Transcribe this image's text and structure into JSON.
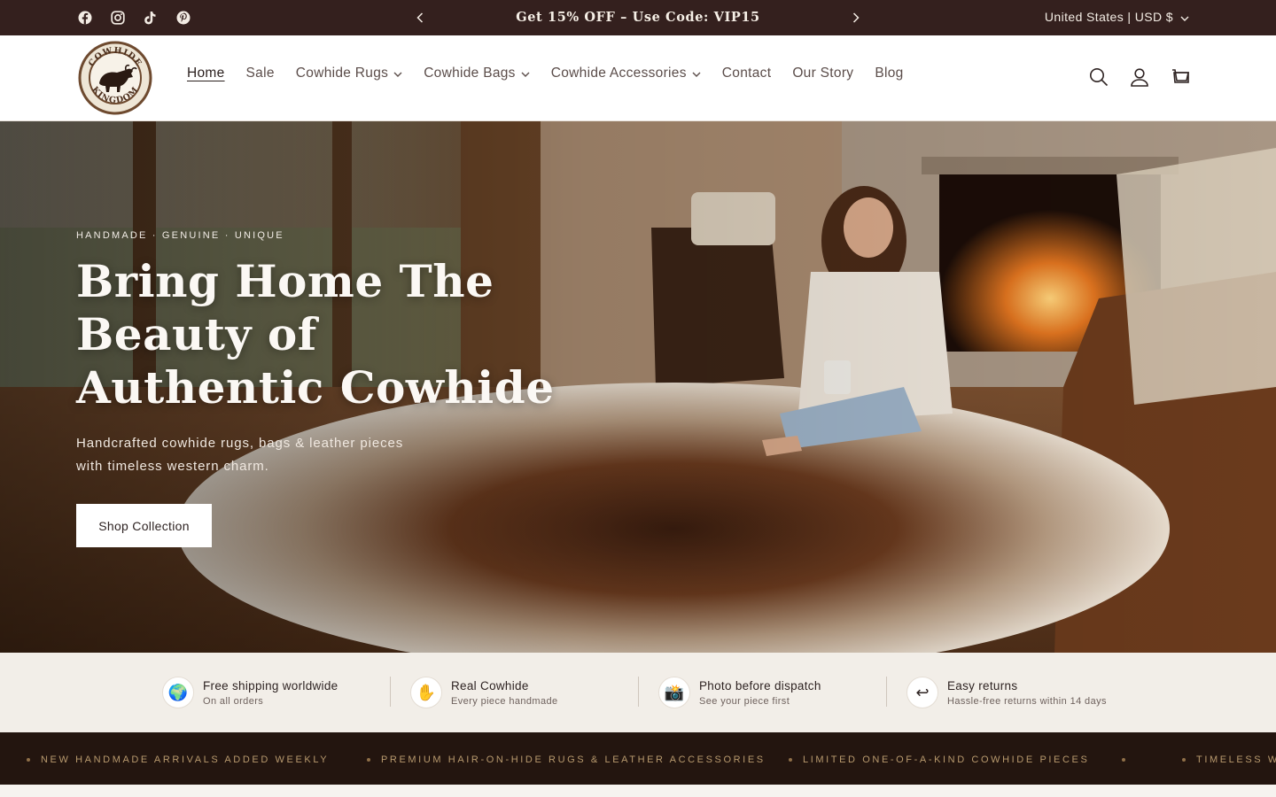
{
  "announcement": {
    "text": "Get 15% OFF – Use Code: VIP15",
    "locale": "United States | USD $"
  },
  "social": [
    "facebook-icon",
    "instagram-icon",
    "tiktok-icon",
    "pinterest-icon"
  ],
  "logo": {
    "top_text": "COWHIDE",
    "bottom_text": "KINGDOM"
  },
  "nav": [
    {
      "label": "Home",
      "active": true,
      "dropdown": false
    },
    {
      "label": "Sale",
      "dropdown": false
    },
    {
      "label": "Cowhide Rugs",
      "dropdown": true
    },
    {
      "label": "Cowhide Bags",
      "dropdown": true
    },
    {
      "label": "Cowhide Accessories",
      "dropdown": true
    },
    {
      "label": "Contact",
      "dropdown": false
    },
    {
      "label": "Our Story",
      "dropdown": false
    },
    {
      "label": "Blog",
      "dropdown": false
    }
  ],
  "hero": {
    "eyebrow": "HANDMADE · GENUINE · UNIQUE",
    "headline": "Bring Home The Beauty of Authentic Cowhide",
    "subtext": "Handcrafted cowhide rugs, bags & leather pieces with timeless western charm.",
    "cta": "Shop Collection"
  },
  "features": [
    {
      "icon": "globe-icon",
      "glyph": "🌍",
      "title": "Free shipping worldwide",
      "subtitle": "On all orders"
    },
    {
      "icon": "hand-icon",
      "glyph": "✋",
      "title": "Real Cowhide",
      "subtitle": "Every piece handmade"
    },
    {
      "icon": "camera-icon",
      "glyph": "📸",
      "title": "Photo before dispatch",
      "subtitle": "See your piece first"
    },
    {
      "icon": "return-icon",
      "glyph": "↩",
      "title": "Easy returns",
      "subtitle": "Hassle-free returns within 14 days"
    }
  ],
  "marquee": [
    "NEW HANDMADE ARRIVALS ADDED WEEKLY",
    "PREMIUM HAIR-ON-HIDE RUGS & LEATHER ACCESSORIES",
    "LIMITED ONE-OF-A-KIND COWHIDE PIECES",
    "TIMELESS WE"
  ],
  "colors": {
    "topbar": "#34201e",
    "marquee_bg": "#23150f",
    "marquee_text": "#b89a6e",
    "features_bg": "#f2eee8"
  }
}
